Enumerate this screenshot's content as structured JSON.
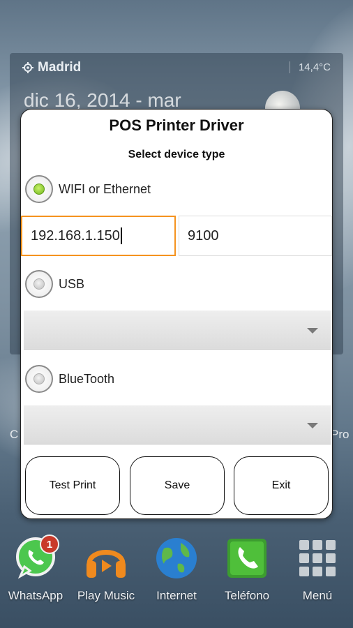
{
  "background": {
    "weather_widget": {
      "location": "Madrid",
      "temperature": "14,4°C",
      "date": "dic 16, 2014 - mar"
    },
    "side_left": "C",
    "side_right": "Pro"
  },
  "dock": [
    {
      "label": "WhatsApp",
      "badge": "1",
      "icon": "whatsapp-icon"
    },
    {
      "label": "Play Music",
      "icon": "headphones-icon"
    },
    {
      "label": "Internet",
      "icon": "globe-icon"
    },
    {
      "label": "Teléfono",
      "icon": "phone-icon"
    },
    {
      "label": "Menú",
      "icon": "apps-grid-icon"
    }
  ],
  "dialog": {
    "title": "POS Printer Driver",
    "subtitle": "Select device type",
    "options": {
      "wifi": {
        "label": "WIFI or Ethernet",
        "checked": true
      },
      "usb": {
        "label": "USB",
        "checked": false
      },
      "bluetooth": {
        "label": "BlueTooth",
        "checked": false
      }
    },
    "ip_address": "192.168.1.150",
    "port": "9100",
    "usb_device": "",
    "bluetooth_device": "",
    "buttons": {
      "test_print": "Test Print",
      "save": "Save",
      "exit": "Exit"
    }
  },
  "colors": {
    "focus_border": "#f5931f",
    "radio_checked": "#6fb51a"
  }
}
